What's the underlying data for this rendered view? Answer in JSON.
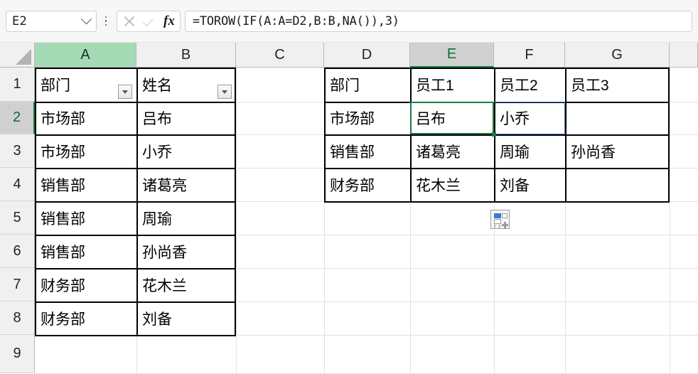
{
  "formula_bar": {
    "name_box_value": "E2",
    "formula": "=TOROW(IF(A:A=D2,B:B,NA()),3)",
    "fx_label": "fx",
    "cancel_icon": "close-icon",
    "enter_icon": "check-icon",
    "dropdown_icon": "chevron-down-icon",
    "more_icon": "kebab-menu-icon"
  },
  "grid": {
    "column_headers": [
      "A",
      "B",
      "C",
      "D",
      "E",
      "F",
      "G"
    ],
    "row_headers": [
      "1",
      "2",
      "3",
      "4",
      "5",
      "6",
      "7",
      "8",
      "9"
    ],
    "selected_column": "E",
    "selected_row": "2",
    "active_cell": "E2",
    "spill_range": "E2:F2",
    "colors": {
      "header_fill": "#f0f0f0",
      "header_selected_soft": "#a6dab7",
      "header_selected_active": "#d0d0d0",
      "active_border": "#1b7a44",
      "spill_border": "#4a79c7",
      "gridline": "#e2e2e2",
      "table_border": "#000000"
    }
  },
  "left_table": {
    "headers": [
      "部门",
      "姓名"
    ],
    "has_autofilter": true,
    "rows": [
      [
        "市场部",
        "吕布"
      ],
      [
        "市场部",
        "小乔"
      ],
      [
        "销售部",
        "诸葛亮"
      ],
      [
        "销售部",
        "周瑜"
      ],
      [
        "销售部",
        "孙尚香"
      ],
      [
        "财务部",
        "花木兰"
      ],
      [
        "财务部",
        "刘备"
      ]
    ]
  },
  "right_table": {
    "headers": [
      "部门",
      "员工1",
      "员工2",
      "员工3"
    ],
    "rows": [
      [
        "市场部",
        "吕布",
        "小乔",
        ""
      ],
      [
        "销售部",
        "诸葛亮",
        "周瑜",
        "孙尚香"
      ],
      [
        "财务部",
        "花木兰",
        "刘备",
        ""
      ]
    ]
  },
  "spill_options": {
    "icon": "paste-options-icon",
    "tooltip": ""
  }
}
